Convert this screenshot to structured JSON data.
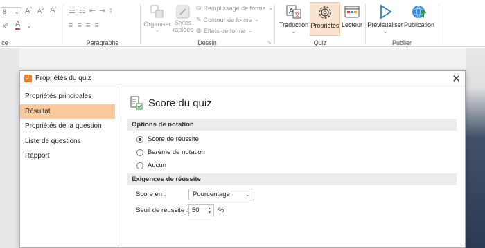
{
  "ribbon": {
    "font": {
      "size": "8",
      "grow": "A",
      "shrink": "A",
      "superscript": "x²",
      "color_label": "A"
    },
    "groups": {
      "font_partial": "ce",
      "paragraph": "Paragraphe",
      "drawing": "Dessin",
      "quiz": "Quiz",
      "publish": "Publier"
    },
    "drawing": {
      "organize": "Organiser",
      "styles": "Styles",
      "styles2": "rapides",
      "fill": "Remplissage de forme",
      "outline": "Contour de forme",
      "effects": "Effets de forme"
    },
    "quiz": {
      "translation": "Traduction",
      "properties": "Propriétés",
      "player": "Lecteur"
    },
    "publish": {
      "preview": "Prévisualiser",
      "publish": "Publication"
    },
    "colors": {
      "accent": "#f07f1b",
      "active_bg": "#fbe5d1"
    }
  },
  "dialog": {
    "title": "Propriétés du quiz",
    "close_glyph": "✕",
    "sidebar": [
      {
        "label": "Propriétés principales",
        "selected": false
      },
      {
        "label": "Résultat",
        "selected": true
      },
      {
        "label": "Propriétés de la question",
        "selected": false
      },
      {
        "label": "Liste de questions",
        "selected": false
      },
      {
        "label": "Rapport",
        "selected": false
      }
    ],
    "heading": "Score du quiz",
    "scoring": {
      "title": "Options de notation",
      "options": [
        "Score de réussite",
        "Barème de notation",
        "Aucun"
      ],
      "selected_index": 0
    },
    "requirements": {
      "title": "Exigences de réussite",
      "score_label": "Score en :",
      "score_value": "Pourcentage",
      "threshold_label": "Seuil de réussite :",
      "threshold_value": "50",
      "unit": "%"
    }
  }
}
